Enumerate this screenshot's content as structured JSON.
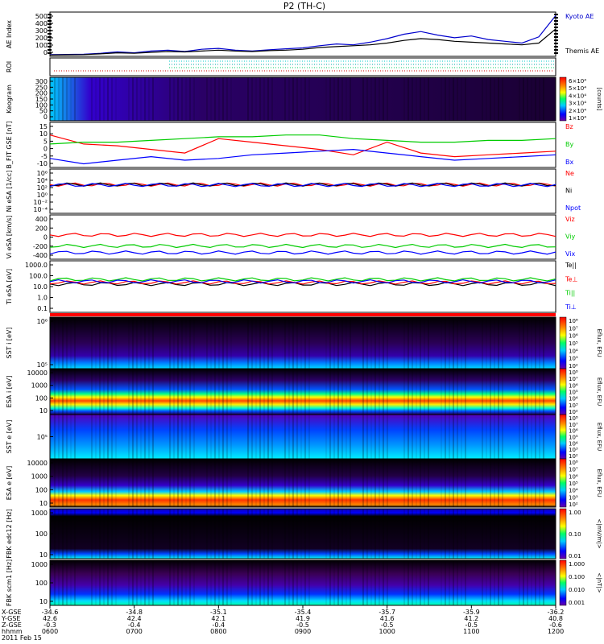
{
  "title": "P2 (TH-C)",
  "chart_data": [
    {
      "id": "ae",
      "type": "line",
      "ylabel": "AE Index",
      "yticks": [
        "500",
        "400",
        "300",
        "200",
        "100",
        "0"
      ],
      "ylim": [
        0,
        500
      ],
      "series": [
        {
          "name": "Kyoto AE",
          "color": "#0000cc",
          "x": [
            0,
            1,
            2,
            3,
            4,
            5,
            6,
            7,
            8,
            9,
            10,
            11,
            12,
            13,
            14,
            15,
            16,
            17,
            18,
            19,
            20,
            21,
            22,
            23,
            24,
            25,
            26,
            27,
            28,
            29,
            30
          ],
          "values": [
            20,
            22,
            25,
            35,
            50,
            40,
            60,
            70,
            55,
            80,
            90,
            70,
            60,
            75,
            85,
            95,
            120,
            140,
            130,
            160,
            200,
            250,
            280,
            240,
            210,
            230,
            190,
            170,
            150,
            220,
            460
          ]
        },
        {
          "name": "Themis AE",
          "color": "#000000",
          "x": [
            0,
            1,
            2,
            3,
            4,
            5,
            6,
            7,
            8,
            9,
            10,
            11,
            12,
            13,
            14,
            15,
            16,
            17,
            18,
            19,
            20,
            21,
            22,
            23,
            24,
            25,
            26,
            27,
            28,
            29,
            30
          ],
          "values": [
            15,
            18,
            20,
            28,
            40,
            35,
            45,
            55,
            50,
            60,
            70,
            60,
            55,
            65,
            70,
            80,
            100,
            110,
            120,
            130,
            150,
            180,
            200,
            190,
            170,
            160,
            150,
            140,
            130,
            150,
            310
          ]
        }
      ]
    },
    {
      "id": "roi",
      "type": "bar",
      "ylabel": "ROI"
    },
    {
      "id": "keogram",
      "type": "heatmap",
      "ylabel": "Keogram",
      "yticks": [
        "300",
        "250",
        "200",
        "150",
        "100",
        "50",
        "0"
      ],
      "ylim": [
        0,
        300
      ],
      "colorbar": {
        "label": "[counts]",
        "ticks": [
          "6×10⁴",
          "5×10⁴",
          "4×10⁴",
          "3×10⁴",
          "2×10⁴",
          "1×10⁴"
        ]
      }
    },
    {
      "id": "bfgm",
      "type": "line",
      "ylabel": "B_FIT GSE [nT]",
      "yticks": [
        "15",
        "10",
        "5",
        "0",
        "-5",
        "-10"
      ],
      "ylim": [
        -10,
        15
      ],
      "series": [
        {
          "name": "Bz",
          "color": "#ff0000",
          "x": [
            0,
            2,
            4,
            6,
            8,
            10,
            12,
            14,
            16,
            18,
            20,
            22,
            24,
            26,
            28,
            30
          ],
          "values": [
            8,
            3,
            2,
            0,
            -2,
            6,
            4,
            2,
            0,
            -3,
            4,
            -2,
            -4,
            -3,
            -2,
            -1
          ]
        },
        {
          "name": "By",
          "color": "#00cc00",
          "x": [
            0,
            2,
            4,
            6,
            8,
            10,
            12,
            14,
            16,
            18,
            20,
            22,
            24,
            26,
            28,
            30
          ],
          "values": [
            3,
            4,
            4,
            5,
            6,
            7,
            7,
            8,
            8,
            6,
            5,
            4,
            4,
            5,
            5,
            6
          ]
        },
        {
          "name": "Bx",
          "color": "#0000ff",
          "x": [
            0,
            2,
            4,
            6,
            8,
            10,
            12,
            14,
            16,
            18,
            20,
            22,
            24,
            26,
            28,
            30
          ],
          "values": [
            -5,
            -8,
            -6,
            -4,
            -6,
            -5,
            -3,
            -2,
            -1,
            0,
            -2,
            -4,
            -6,
            -5,
            -4,
            -3
          ]
        }
      ]
    },
    {
      "id": "ni",
      "type": "line",
      "ylabel": "Ni eSA [1/cc]",
      "yticks": [
        "10⁶",
        "10⁴",
        "10²",
        "10⁰",
        "10⁻²",
        "10⁻⁴"
      ],
      "series": [
        {
          "name": "Ne",
          "color": "#ff0000"
        },
        {
          "name": "Ni",
          "color": "#000000"
        },
        {
          "name": "Npot",
          "color": "#0000ff"
        }
      ]
    },
    {
      "id": "vi",
      "type": "line",
      "ylabel": "Vi eSA [km/s]",
      "yticks": [
        "400",
        "200",
        "0",
        "-200",
        "-400"
      ],
      "ylim": [
        -500,
        500
      ],
      "series": [
        {
          "name": "Viz",
          "color": "#ff0000"
        },
        {
          "name": "Viy",
          "color": "#00cc00"
        },
        {
          "name": "Vix",
          "color": "#0000ff"
        }
      ]
    },
    {
      "id": "ti",
      "type": "line",
      "ylabel": "Ti eSA [eV]",
      "yticks": [
        "1000.0",
        "100.0",
        "10.0",
        "1.0",
        "0.1"
      ],
      "series": [
        {
          "name": "Te||",
          "color": "#000000"
        },
        {
          "name": "Te⊥",
          "color": "#ff0000"
        },
        {
          "name": "Ti||",
          "color": "#00cc00"
        },
        {
          "name": "Ti⊥",
          "color": "#0000ff"
        }
      ]
    },
    {
      "id": "sst_i",
      "type": "heatmap",
      "ylabel": "SST i [eV]",
      "yticks": [
        "10⁶",
        "10⁵"
      ],
      "colorbar": {
        "label": "Eflux, EFU",
        "ticks": [
          "10⁸",
          "10⁷",
          "10⁶",
          "10⁵",
          "10⁴",
          "10³",
          "10²"
        ]
      }
    },
    {
      "id": "esa_i",
      "type": "heatmap",
      "ylabel": "ESA i [eV]",
      "yticks": [
        "10000",
        "1000",
        "100",
        "10"
      ],
      "colorbar": {
        "label": "Eflux, EFU",
        "ticks": [
          "10⁸",
          "10⁷",
          "10⁶",
          "10⁵",
          "10⁴",
          "10³",
          "10²"
        ]
      }
    },
    {
      "id": "sst_e",
      "type": "heatmap",
      "ylabel": "SST e [eV]",
      "yticks": [
        "10⁵"
      ],
      "colorbar": {
        "label": "Eflux, EFU",
        "ticks": [
          "10⁸",
          "10⁷",
          "10⁶",
          "10⁵",
          "10⁴",
          "10³",
          "10²"
        ]
      }
    },
    {
      "id": "esa_e",
      "type": "heatmap",
      "ylabel": "ESA e [eV]",
      "yticks": [
        "10000",
        "1000",
        "100",
        "10"
      ],
      "colorbar": {
        "label": "Eflux, EFU",
        "ticks": [
          "10⁸",
          "10⁷",
          "10⁶",
          "10⁵",
          "10⁴",
          "10³",
          "10²"
        ]
      }
    },
    {
      "id": "fbk1",
      "type": "heatmap",
      "ylabel": "FBK edc12 [Hz]",
      "yticks": [
        "1000",
        "100",
        "10"
      ],
      "colorbar": {
        "label": "<|mV/m|>",
        "ticks": [
          "1.00",
          "0.10",
          "0.01"
        ]
      }
    },
    {
      "id": "fbk2",
      "type": "heatmap",
      "ylabel": "FBK scm1 [Hz]",
      "yticks": [
        "1000",
        "100",
        "10"
      ],
      "colorbar": {
        "label": "<|nT|>",
        "ticks": [
          "1.000",
          "0.100",
          "0.010",
          "0.001"
        ]
      }
    }
  ],
  "xaxis": {
    "rows": [
      {
        "label": "X-GSE",
        "values": [
          "-34.6",
          "-34.8",
          "-35.1",
          "-35.4",
          "-35.7",
          "-35.9",
          "-36.2"
        ]
      },
      {
        "label": "Y-GSE",
        "values": [
          "42.6",
          "42.4",
          "42.1",
          "41.9",
          "41.6",
          "41.2",
          "40.8"
        ]
      },
      {
        "label": "Z-GSE",
        "values": [
          "-0.3",
          "-0.4",
          "-0.4",
          "-0.5",
          "-0.5",
          "-0.5",
          "-0.6"
        ]
      },
      {
        "label": "hhmm",
        "values": [
          "0600",
          "0700",
          "0800",
          "0900",
          "1000",
          "1100",
          "1200"
        ]
      }
    ],
    "date": "2011 Feb 15"
  }
}
